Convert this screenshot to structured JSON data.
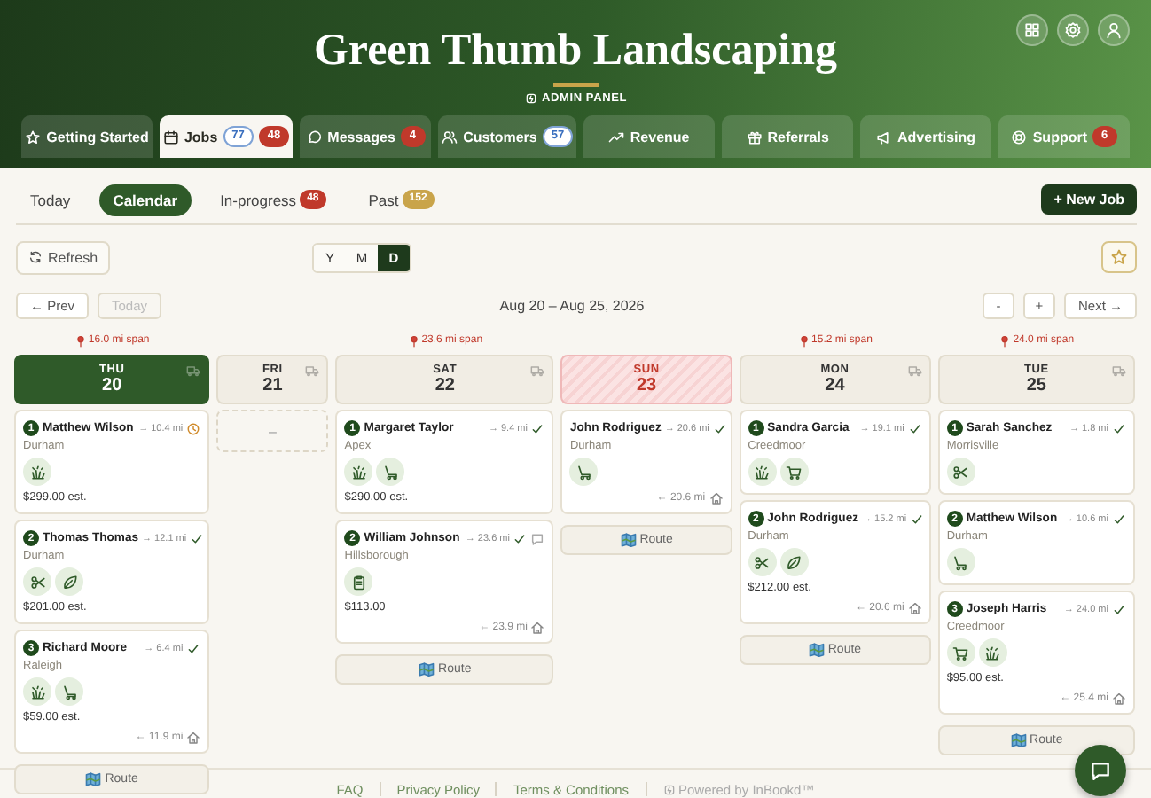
{
  "header": {
    "title": "Green Thumb Landscaping",
    "subtitle": "ADMIN PANEL"
  },
  "tabs": [
    {
      "label": "Getting Started",
      "selected": false
    },
    {
      "label": "Jobs",
      "selected": true,
      "badges": [
        {
          "text": "77",
          "kind": "count"
        },
        {
          "text": "48",
          "kind": "alert"
        }
      ]
    },
    {
      "label": "Messages",
      "selected": false,
      "badges": [
        {
          "text": "4",
          "kind": "alert"
        }
      ]
    },
    {
      "label": "Customers",
      "selected": false,
      "badges": [
        {
          "text": "57",
          "kind": "count"
        }
      ]
    },
    {
      "label": "Revenue",
      "selected": false
    },
    {
      "label": "Referrals",
      "selected": false
    },
    {
      "label": "Advertising",
      "selected": false
    },
    {
      "label": "Support",
      "selected": false,
      "badges": [
        {
          "text": "6",
          "kind": "alert"
        }
      ]
    }
  ],
  "subtabs": [
    {
      "label": "Today",
      "selected": false
    },
    {
      "label": "Calendar",
      "selected": true
    },
    {
      "label": "In-progress",
      "selected": false,
      "badge": {
        "text": "48",
        "kind": "alert"
      }
    },
    {
      "label": "Past",
      "selected": false,
      "badge": {
        "text": "152",
        "kind": "archive"
      }
    }
  ],
  "new_job_button": "+ New Job",
  "refresh_button": "Refresh",
  "view_modes": [
    {
      "label": "Y",
      "selected": false
    },
    {
      "label": "M",
      "selected": false
    },
    {
      "label": "D",
      "selected": true
    }
  ],
  "nav": {
    "prev": "← Prev",
    "today": {
      "label": "Today",
      "disabled": true
    },
    "range": "Aug 20 – Aug 25, 2026",
    "zoom_out": "-",
    "zoom_in": "+",
    "next": "Next →"
  },
  "days": [
    {
      "weekday": "THU",
      "date": "20",
      "span": "16.0 mi span",
      "today": true,
      "blocked": false,
      "route": "Route",
      "jobs": [
        {
          "number": "1",
          "name": "Matthew Wilson",
          "distance": "→ 10.4 mi",
          "confirmed": false,
          "location": "Durham",
          "services": [
            {
              "kind": "grass"
            }
          ],
          "price": "$299.00 est."
        },
        {
          "number": "2",
          "name": "Thomas Thomas",
          "distance": "→ 12.1 mi",
          "confirmed": true,
          "location": "Durham",
          "services": [
            {
              "kind": "scissors"
            },
            {
              "kind": "leaf"
            }
          ],
          "price": "$201.00 est."
        },
        {
          "number": "3",
          "name": "Richard Moore",
          "distance": "→ 6.4 mi",
          "confirmed": true,
          "location": "Raleigh",
          "services": [
            {
              "kind": "grass"
            },
            {
              "kind": "mower"
            }
          ],
          "price": "$59.00 est.",
          "return": "← 11.9 mi"
        }
      ]
    },
    {
      "weekday": "FRI",
      "date": "21",
      "today": false,
      "blocked": false,
      "empty": "–"
    },
    {
      "weekday": "SAT",
      "date": "22",
      "span": "23.6 mi span",
      "today": false,
      "blocked": false,
      "route": "Route",
      "jobs": [
        {
          "number": "1",
          "name": "Margaret Taylor",
          "distance": "→ 9.4 mi",
          "confirmed": true,
          "location": "Apex",
          "services": [
            {
              "kind": "grass"
            },
            {
              "kind": "mower"
            }
          ],
          "price": "$290.00 est."
        },
        {
          "number": "2",
          "name": "William Johnson",
          "distance": "→ 23.6 mi",
          "confirmed": true,
          "has_message": true,
          "location": "Hillsborough",
          "services": [
            {
              "kind": "clipboard"
            }
          ],
          "price": "$113.00",
          "return": "← 23.9 mi"
        }
      ]
    },
    {
      "weekday": "SUN",
      "date": "23",
      "today": false,
      "blocked": true,
      "route": "Route",
      "jobs": [
        {
          "name": "John Rodriguez",
          "distance": "→ 20.6 mi",
          "confirmed": true,
          "location": "Durham",
          "services": [
            {
              "kind": "mower"
            }
          ],
          "return": "← 20.6 mi"
        }
      ]
    },
    {
      "weekday": "MON",
      "date": "24",
      "span": "15.2 mi span",
      "today": false,
      "blocked": false,
      "route": "Route",
      "jobs": [
        {
          "number": "1",
          "name": "Sandra Garcia",
          "distance": "→ 19.1 mi",
          "confirmed": true,
          "location": "Creedmoor",
          "services": [
            {
              "kind": "grass"
            },
            {
              "kind": "cart"
            }
          ]
        },
        {
          "number": "2",
          "name": "John Rodriguez",
          "distance": "→ 15.2 mi",
          "confirmed": true,
          "location": "Durham",
          "services": [
            {
              "kind": "scissors"
            },
            {
              "kind": "leaf"
            }
          ],
          "price": "$212.00 est.",
          "return": "← 20.6 mi"
        }
      ]
    },
    {
      "weekday": "TUE",
      "date": "25",
      "span": "24.0 mi span",
      "today": false,
      "blocked": false,
      "route": "Route",
      "jobs": [
        {
          "number": "1",
          "name": "Sarah Sanchez",
          "distance": "→ 1.8 mi",
          "confirmed": true,
          "location": "Morrisville",
          "services": [
            {
              "kind": "scissors"
            }
          ]
        },
        {
          "number": "2",
          "name": "Matthew Wilson",
          "distance": "→ 10.6 mi",
          "confirmed": true,
          "location": "Durham",
          "services": [
            {
              "kind": "mower"
            }
          ]
        },
        {
          "number": "3",
          "name": "Joseph Harris",
          "distance": "→ 24.0 mi",
          "confirmed": true,
          "location": "Creedmoor",
          "services": [
            {
              "kind": "cart"
            },
            {
              "kind": "grass"
            }
          ],
          "price": "$95.00 est.",
          "return": "← 25.4 mi"
        }
      ]
    }
  ],
  "footer": {
    "links": [
      "FAQ",
      "Privacy Policy",
      "Terms & Conditions"
    ],
    "powered_by": "Powered by InBookd™"
  }
}
